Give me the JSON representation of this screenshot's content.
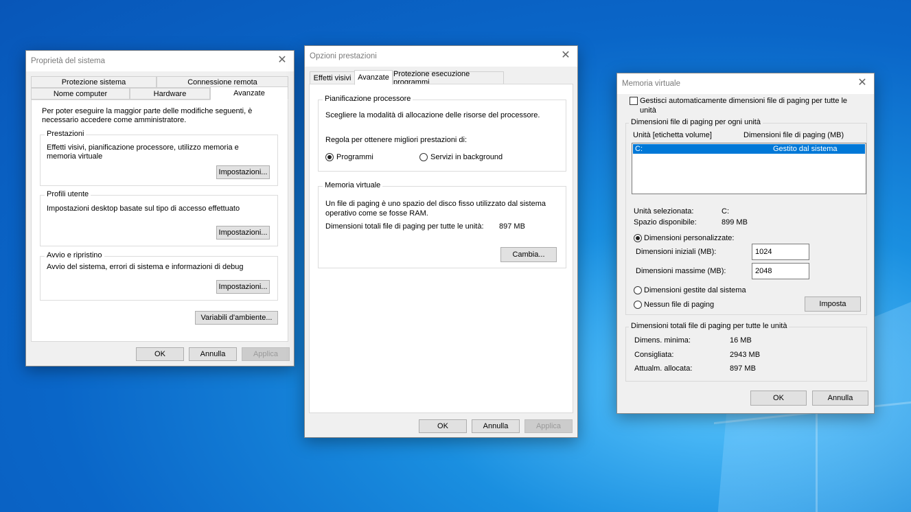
{
  "desktop": {
    "icon": "windows-logo-light"
  },
  "sysprops": {
    "title": "Proprietà del sistema",
    "tabs_row1": [
      "Protezione sistema",
      "Connessione remota"
    ],
    "tabs_row2": [
      "Nome computer",
      "Hardware",
      "Avanzate"
    ],
    "intro": "Per poter eseguire la maggior parte delle modifiche seguenti, è necessario accedere come amministratore.",
    "perf_label": "Prestazioni",
    "perf_desc": "Effetti visivi, pianificazione processore, utilizzo memoria e memoria virtuale",
    "profiles_label": "Profili utente",
    "profiles_desc": "Impostazioni desktop basate sul tipo di accesso effettuato",
    "startup_label": "Avvio e ripristino",
    "startup_desc": "Avvio del sistema, errori di sistema e informazioni di debug",
    "settings_btn": "Impostazioni...",
    "env_btn": "Variabili d'ambiente...",
    "ok": "OK",
    "cancel": "Annulla",
    "apply": "Applica"
  },
  "perfopts": {
    "title": "Opzioni prestazioni",
    "tabs": [
      "Effetti visivi",
      "Avanzate",
      "Protezione esecuzione programmi"
    ],
    "sched_label": "Pianificazione processore",
    "sched_desc": "Scegliere la modalità di allocazione delle risorse del processore.",
    "adjust_label": "Regola per ottenere migliori prestazioni di:",
    "radio_programs": "Programmi",
    "radio_services": "Servizi in background",
    "vm_label": "Memoria virtuale",
    "vm_desc": "Un file di paging è uno spazio del disco fisso utilizzato dal sistema operativo come se fosse RAM.",
    "vm_total_label": "Dimensioni totali file di paging per tutte le unità:",
    "vm_total_value": "897 MB",
    "change_btn": "Cambia...",
    "ok": "OK",
    "cancel": "Annulla",
    "apply": "Applica"
  },
  "vmem": {
    "title": "Memoria virtuale",
    "auto_checkbox": "Gestisci automaticamente dimensioni file di paging per tutte le unità",
    "per_drive_label": "Dimensioni file di paging per ogni unità",
    "col_drive": "Unità [etichetta volume]",
    "col_size": "Dimensioni file di paging (MB)",
    "rows": [
      {
        "drive": "C:",
        "size": "Gestito dal sistema"
      }
    ],
    "selected_drive_label": "Unità selezionata:",
    "selected_drive_value": "C:",
    "free_space_label": "Spazio disponibile:",
    "free_space_value": "899 MB",
    "radio_custom": "Dimensioni personalizzate:",
    "initial_label": "Dimensioni iniziali (MB):",
    "initial_value": "1024",
    "max_label": "Dimensioni massime (MB):",
    "max_value": "2048",
    "radio_system": "Dimensioni gestite dal sistema",
    "radio_none": "Nessun file di paging",
    "set_btn": "Imposta",
    "totals_label": "Dimensioni totali file di paging per tutte le unità",
    "min_label": "Dimens. minima:",
    "min_value": "16 MB",
    "rec_label": "Consigliata:",
    "rec_value": "2943 MB",
    "alloc_label": "Attualm. allocata:",
    "alloc_value": "897 MB",
    "ok": "OK",
    "cancel": "Annulla"
  }
}
